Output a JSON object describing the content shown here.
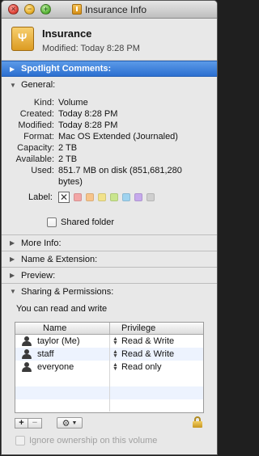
{
  "window": {
    "title": "Insurance Info"
  },
  "header": {
    "name": "Insurance",
    "modified": "Modified: Today 8:28 PM"
  },
  "sections": {
    "spotlight": "Spotlight Comments:",
    "general": "General:",
    "more_info": "More Info:",
    "name_ext": "Name & Extension:",
    "preview": "Preview:",
    "sharing": "Sharing & Permissions:"
  },
  "general": {
    "rows": [
      {
        "key": "Kind:",
        "value": "Volume"
      },
      {
        "key": "Created:",
        "value": "Today 8:28 PM"
      },
      {
        "key": "Modified:",
        "value": "Today 8:28 PM"
      },
      {
        "key": "Format:",
        "value": "Mac OS Extended (Journaled)"
      },
      {
        "key": "Capacity:",
        "value": "2 TB"
      },
      {
        "key": "Available:",
        "value": "2 TB"
      },
      {
        "key": "Used:",
        "value": "851.7 MB on disk (851,681,280 bytes)"
      }
    ],
    "label_key": "Label:",
    "label_colors": [
      "#f3a6a6",
      "#f7c48a",
      "#f1e28a",
      "#c9e58d",
      "#9fd3ef",
      "#c6a9ec",
      "#cfcfcf"
    ],
    "shared_folder": "Shared folder"
  },
  "permissions": {
    "summary": "You can read and write",
    "col_name": "Name",
    "col_priv": "Privilege",
    "rows": [
      {
        "name": "taylor (Me)",
        "priv": "Read & Write",
        "icon": "user-icon"
      },
      {
        "name": "staff",
        "priv": "Read & Write",
        "icon": "group-icon"
      },
      {
        "name": "everyone",
        "priv": "Read only",
        "icon": "group-icon"
      }
    ],
    "ignore_ownership": "Ignore ownership on this volume"
  }
}
